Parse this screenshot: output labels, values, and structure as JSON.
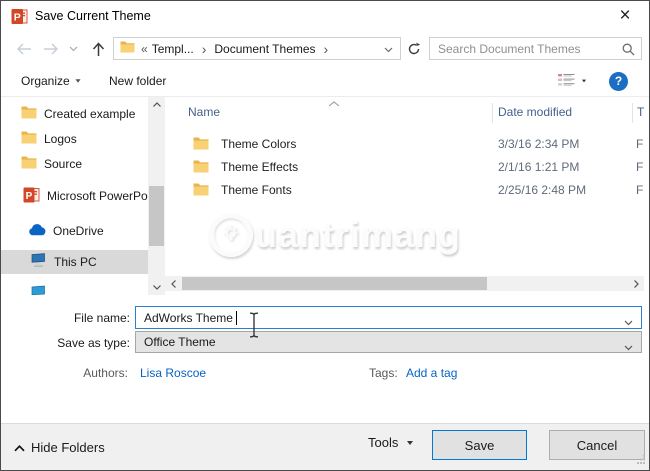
{
  "window": {
    "title": "Save Current Theme"
  },
  "nav": {
    "collapsed_marker": "«",
    "path_segments": [
      "Templ...",
      "Document Themes"
    ],
    "search_placeholder": "Search Document Themes"
  },
  "toolbar": {
    "organize_label": "Organize",
    "new_folder_label": "New folder"
  },
  "sidebar": {
    "items": [
      {
        "label": "Created example",
        "icon": "folder"
      },
      {
        "label": "Logos",
        "icon": "folder"
      },
      {
        "label": "Source",
        "icon": "folder"
      },
      {
        "label": "Microsoft PowerPo",
        "icon": "powerpoint"
      },
      {
        "label": "OneDrive",
        "icon": "onedrive"
      },
      {
        "label": "This PC",
        "icon": "this-pc",
        "selected": true
      },
      {
        "label": "",
        "icon": "network"
      }
    ]
  },
  "file_list": {
    "columns": {
      "name": "Name",
      "date_modified": "Date modified",
      "type": "T"
    },
    "rows": [
      {
        "name": "Theme Colors",
        "date_modified": "3/3/16 2:34 PM",
        "type": "F"
      },
      {
        "name": "Theme Effects",
        "date_modified": "2/1/16 1:21 PM",
        "type": "F"
      },
      {
        "name": "Theme Fonts",
        "date_modified": "2/25/16 2:48 PM",
        "type": "F"
      }
    ]
  },
  "watermark": {
    "text": "uantrimang"
  },
  "form": {
    "file_name_label": "File name:",
    "file_name_value": "AdWorks Theme",
    "save_as_type_label": "Save as type:",
    "save_as_type_value": "Office Theme",
    "authors_label": "Authors:",
    "authors_value": "Lisa Roscoe",
    "tags_label": "Tags:",
    "tags_value": "Add a tag"
  },
  "footer": {
    "hide_folders_label": "Hide Folders",
    "tools_label": "Tools",
    "save_label": "Save",
    "cancel_label": "Cancel"
  },
  "colors": {
    "accent": "#0078d7",
    "link": "#0663c7",
    "column_header_text": "#44618c",
    "selection_bg": "#d9d9d9"
  }
}
